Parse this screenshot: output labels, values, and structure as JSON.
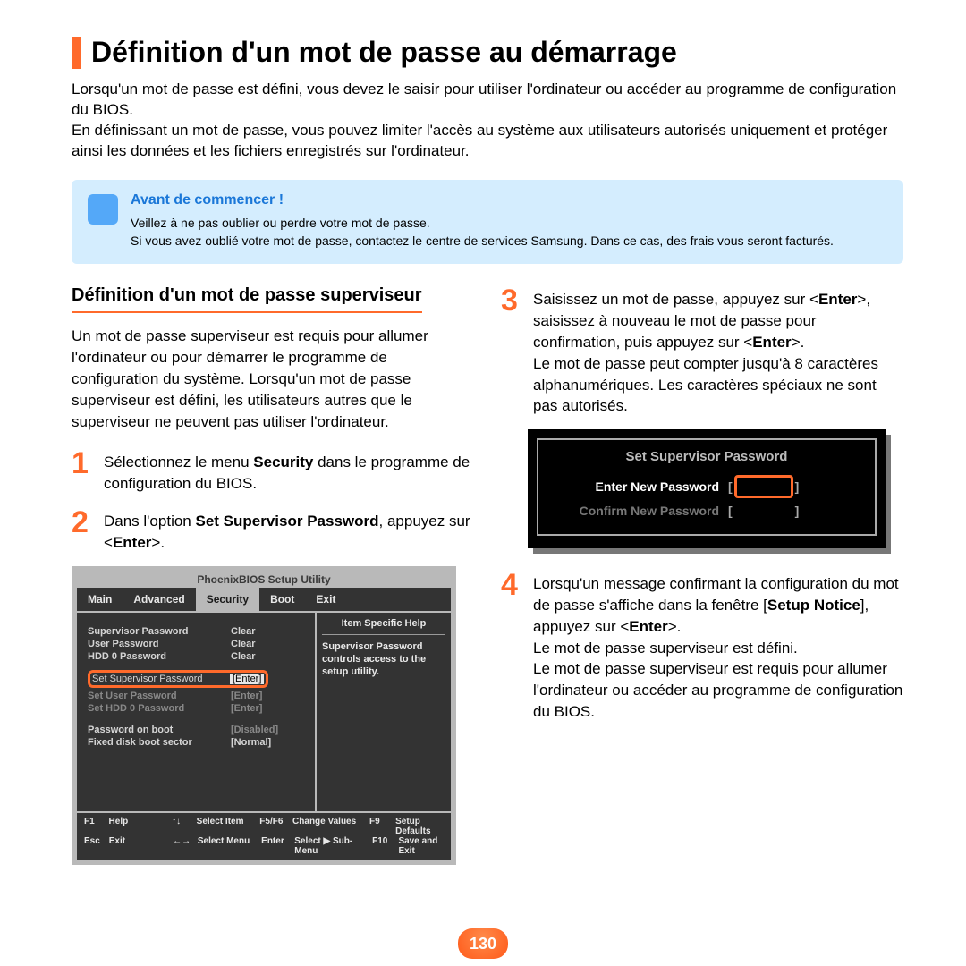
{
  "title": "Définition d'un mot de passe au démarrage",
  "intro_p1": "Lorsqu'un mot de passe est défini, vous devez le saisir pour utiliser l'ordinateur ou accéder au programme de configuration du BIOS.",
  "intro_p2": "En définissant un mot de passe, vous pouvez limiter l'accès au système aux utilisateurs autorisés uniquement et protéger ainsi les données et les fichiers enregistrés sur l'ordinateur.",
  "notice": {
    "title": "Avant de commencer !",
    "line1": "Veillez à ne pas oublier ou perdre votre mot de passe.",
    "line2": "Si vous avez oublié votre mot de passe, contactez le centre de services Samsung. Dans ce cas, des frais vous seront facturés."
  },
  "subheading": "Définition d'un mot de passe superviseur",
  "supervisor_intro": "Un mot de passe superviseur est requis pour allumer l'ordinateur ou pour démarrer le programme de configuration du système. Lorsqu'un mot de passe superviseur est défini, les utilisateurs autres que le superviseur ne peuvent pas utiliser l'ordinateur.",
  "steps": {
    "s1": {
      "n": "1",
      "pre": "Sélectionnez le menu ",
      "bold": "Security",
      "post": " dans le programme de configuration du BIOS."
    },
    "s2": {
      "n": "2",
      "pre": "Dans l'option ",
      "bold": "Set Supervisor Password",
      "mid": ", appuyez sur <",
      "bold2": "Enter",
      "post": ">."
    },
    "s3": {
      "n": "3",
      "text_a": "Saisissez un mot de passe, appuyez sur <",
      "b1": "Enter",
      "text_b": ">, saisissez à nouveau le mot de passe pour confirmation, puis appuyez sur <",
      "b2": "Enter",
      "text_c": ">.",
      "text_d": "Le mot de passe peut compter jusqu'à 8 caractères alphanumériques. Les caractères spéciaux ne sont pas autorisés."
    },
    "s4": {
      "n": "4",
      "a": "Lorsqu'un message confirmant la configuration du mot de passe s'affiche dans la fenêtre [",
      "b1": "Setup Notice",
      "b": "], appuyez sur <",
      "b2": "Enter",
      "c": ">.",
      "d": "Le mot de passe superviseur est défini.",
      "e": "Le mot de passe superviseur est requis pour allumer l'ordinateur ou accéder au programme de configuration du BIOS."
    }
  },
  "bios": {
    "utility_title": "PhoenixBIOS Setup Utility",
    "menu": [
      "Main",
      "Advanced",
      "Security",
      "Boot",
      "Exit"
    ],
    "active_menu_index": 2,
    "help_title": "Item Specific Help",
    "help_text": "Supervisor Password controls access to the setup utility.",
    "rows": [
      {
        "k": "Supervisor Password",
        "v": "Clear"
      },
      {
        "k": "User Password",
        "v": "Clear"
      },
      {
        "k": "HDD 0 Password",
        "v": "Clear"
      }
    ],
    "hl": {
      "k": "Set Supervisor Password",
      "v": "[Enter]"
    },
    "rows2": [
      {
        "k": "Set User Password",
        "v": "[Enter]",
        "dim": true
      },
      {
        "k": "Set HDD 0 Password",
        "v": "[Enter]",
        "dim": true
      }
    ],
    "rows3": [
      {
        "k": "Password on boot",
        "v": "[Disabled]",
        "dim": true
      },
      {
        "k": "Fixed disk boot sector",
        "v": "[Normal]"
      }
    ],
    "footer": {
      "f1": "F1",
      "help": "Help",
      "updown": "↑↓",
      "selitem": "Select Item",
      "f5f6": "F5/F6",
      "chval": "Change Values",
      "f9": "F9",
      "setdef": "Setup Defaults",
      "esc": "Esc",
      "exit": "Exit",
      "lr": "←→",
      "selmenu": "Select Menu",
      "enter": "Enter",
      "selsub": "Select ▶ Sub-Menu",
      "f10": "F10",
      "save": "Save and Exit"
    }
  },
  "pw_dialog": {
    "title": "Set Supervisor Password",
    "row1": "Enter New Password",
    "row2": "Confirm New Password"
  },
  "page_number": "130"
}
